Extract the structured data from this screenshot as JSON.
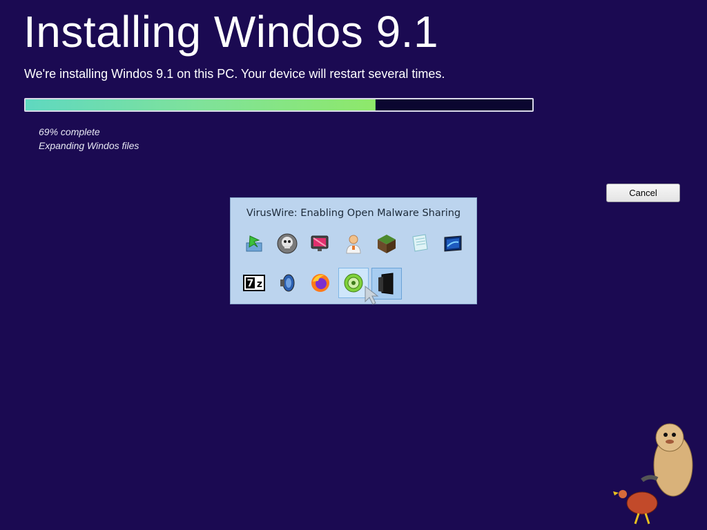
{
  "installer": {
    "title": "Installing Windos 9.1",
    "subtitle": "We're installing Windos 9.1 on this PC. Your device will restart several times.",
    "progress_percent": 69,
    "progress_text": "69% complete",
    "status_text": "Expanding Windos files",
    "cancel_label": "Cancel"
  },
  "switcher": {
    "title": "VirusWire: Enabling Open Malware Sharing",
    "selected_index": 12,
    "icons": [
      {
        "name": "green-arrow-download-icon"
      },
      {
        "name": "skull-gear-icon"
      },
      {
        "name": "monitor-display-icon"
      },
      {
        "name": "doctor-user-icon"
      },
      {
        "name": "minecraft-block-icon"
      },
      {
        "name": "notepad-icon"
      },
      {
        "name": "desktop-wallpaper-icon"
      },
      {
        "name": "seven-zip-icon",
        "text": "7z"
      },
      {
        "name": "speaker-icon"
      },
      {
        "name": "firefox-icon"
      },
      {
        "name": "green-disc-icon"
      },
      {
        "name": "dark-window-icon"
      }
    ]
  },
  "colors": {
    "background": "#1b0a52",
    "progress_fill": "#7fe29a",
    "switcher_bg": "#bcd4ee"
  }
}
